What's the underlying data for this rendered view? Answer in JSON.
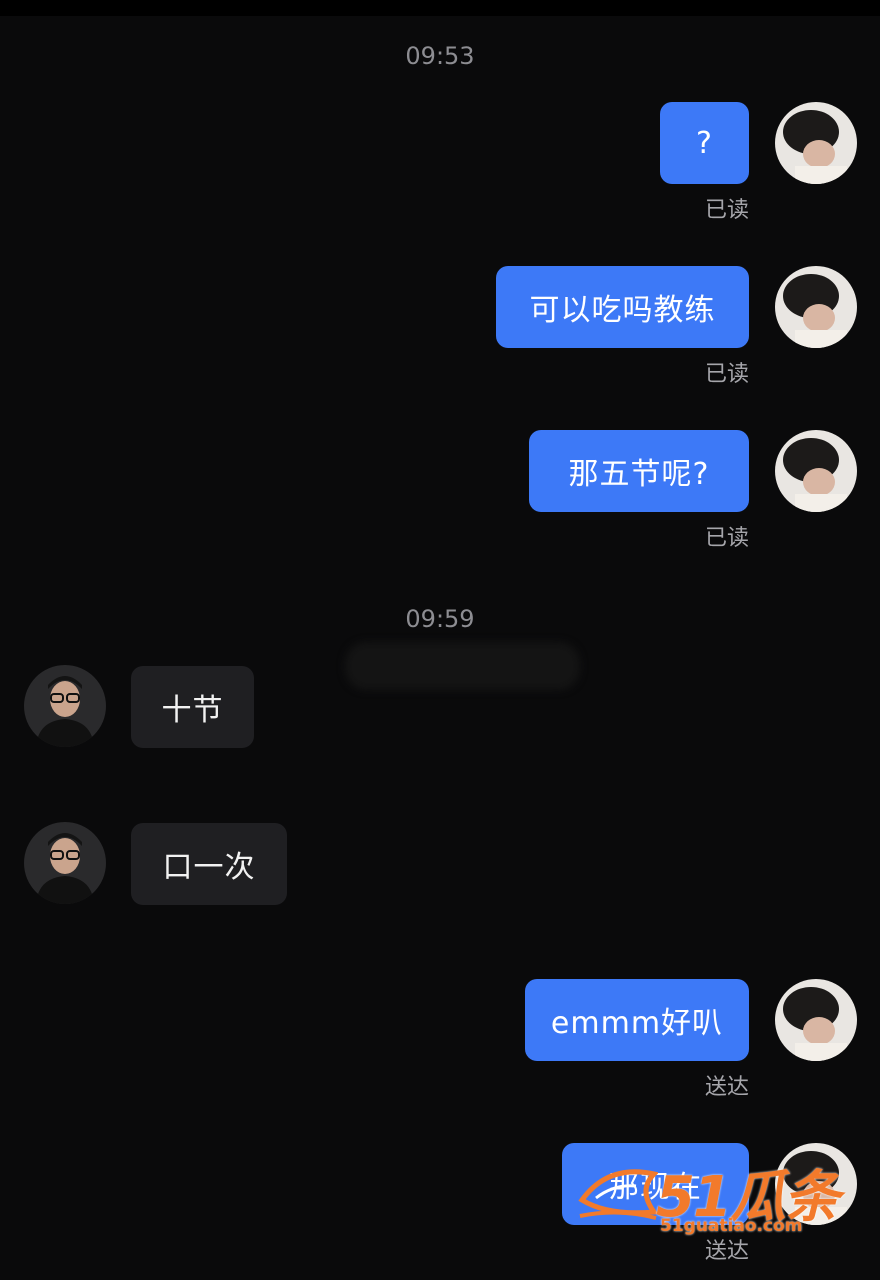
{
  "timestamps": [
    "09:53",
    "09:59"
  ],
  "messages": [
    {
      "side": "out",
      "text": "?",
      "status": "已读"
    },
    {
      "side": "out",
      "text": "可以吃吗教练",
      "status": "已读"
    },
    {
      "side": "out",
      "text": "那五节呢?",
      "status": "已读"
    },
    {
      "side": "in",
      "text": "十节"
    },
    {
      "side": "in",
      "text": "口一次"
    },
    {
      "side": "out",
      "text": "emmm好叭",
      "status": "送达"
    },
    {
      "side": "out",
      "text": "那现在",
      "status": "送达"
    }
  ],
  "watermark": {
    "brand": "51瓜条",
    "url": "51guatiao.com"
  },
  "colors": {
    "background": "#0a0a0b",
    "outgoing_bubble": "#3d79f7",
    "incoming_bubble": "#1f1f22"
  }
}
